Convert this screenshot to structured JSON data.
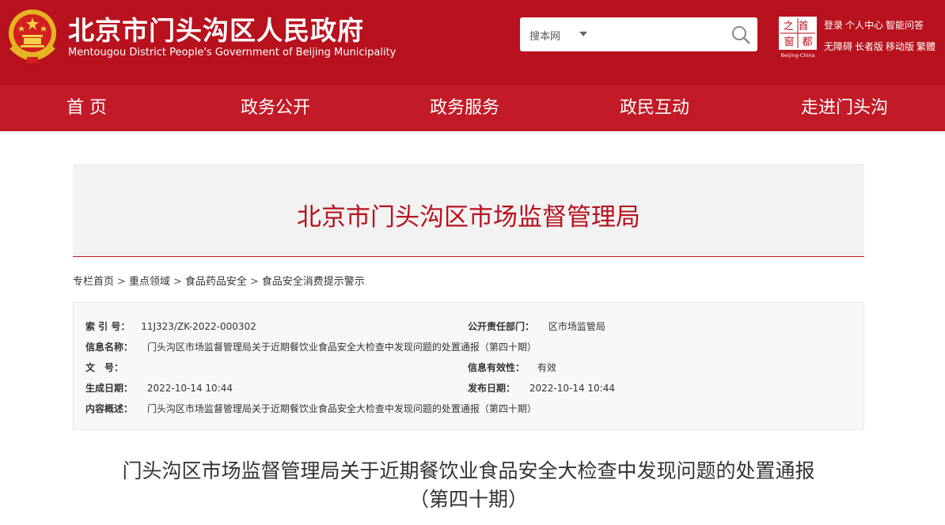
{
  "header": {
    "title": "北京市门头沟区人民政府",
    "subtitle": "Mentougou District People's Government of Beijing Municipality",
    "search": {
      "scope": "搜本网",
      "placeholder": ""
    },
    "capital_logo": {
      "chars": [
        "首",
        "都",
        "之",
        "窗"
      ],
      "caption": "Beijing-China"
    },
    "user_links": [
      "登录",
      "个人中心",
      "智能问答"
    ],
    "access_links": [
      "无障碍",
      "长者版",
      "移动版",
      "繁體"
    ],
    "colors": {
      "brand_red": "#b7121d",
      "nav_red": "#c21a26"
    }
  },
  "nav": {
    "items": [
      "首 页",
      "政务公开",
      "政务服务",
      "政民互动",
      "走进门头沟"
    ]
  },
  "banner": {
    "title": "北京市门头沟区市场监督管理局"
  },
  "breadcrumb": {
    "items": [
      "专栏首页",
      "重点领域",
      "食品药品安全",
      "食品安全消费提示警示"
    ],
    "separator": ">"
  },
  "info": {
    "index_label": "索 引 号：",
    "index_value": "11J323/ZK-2022-000302",
    "dept_label": "公开责任部门：",
    "dept_value": "区市场监管局",
    "name_label": "信息名称：",
    "name_value": "门头沟区市场监督管理局关于近期餐饮业食品安全大检查中发现问题的处置通报（第四十期）",
    "doc_label": "文　号：",
    "doc_value": "",
    "validity_label": "信息有效性：",
    "validity_value": "有效",
    "created_label": "生成日期：",
    "created_value": "2022-10-14 10:44",
    "published_label": "发布日期：",
    "published_value": "2022-10-14 10:44",
    "summary_label": "内容概述：",
    "summary_value": "门头沟区市场监督管理局关于近期餐饮业食品安全大检查中发现问题的处置通报（第四十期）"
  },
  "article": {
    "title_line1": "门头沟区市场监督管理局关于近期餐饮业食品安全大检查中发现问题的处置通报",
    "title_line2": "（第四十期）"
  }
}
